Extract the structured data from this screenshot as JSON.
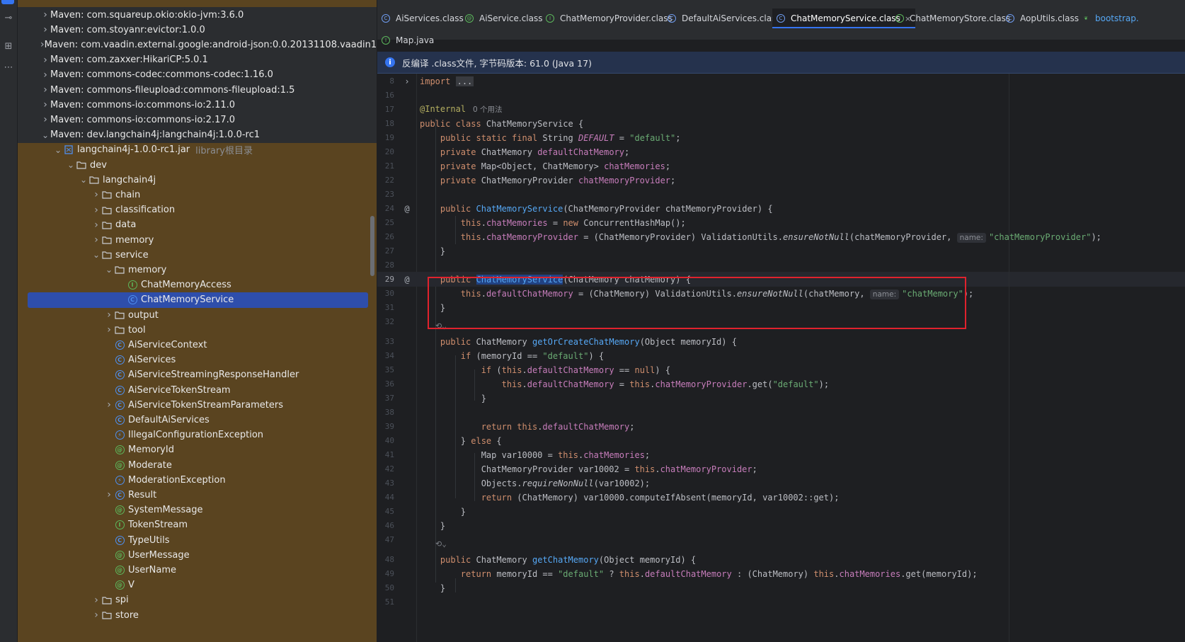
{
  "tool_window": {
    "icons": [
      "commit-icon",
      "structure-icon",
      "more-icon"
    ]
  },
  "project_tree": {
    "rows": [
      {
        "label": "Maven: com.squareup.okio:okio-jvm:3.6.0",
        "depth": 0,
        "type": "library",
        "expanded": false
      },
      {
        "label": "Maven: com.stoyanr:evictor:1.0.0",
        "depth": 0,
        "type": "library",
        "expanded": false
      },
      {
        "label": "Maven: com.vaadin.external.google:android-json:0.0.20131108.vaadin1",
        "depth": 0,
        "type": "library",
        "expanded": false
      },
      {
        "label": "Maven: com.zaxxer:HikariCP:5.0.1",
        "depth": 0,
        "type": "library",
        "expanded": false
      },
      {
        "label": "Maven: commons-codec:commons-codec:1.16.0",
        "depth": 0,
        "type": "library",
        "expanded": false
      },
      {
        "label": "Maven: commons-fileupload:commons-fileupload:1.5",
        "depth": 0,
        "type": "library",
        "expanded": false
      },
      {
        "label": "Maven: commons-io:commons-io:2.11.0",
        "depth": 0,
        "type": "library",
        "expanded": false
      },
      {
        "label": "Maven: commons-io:commons-io:2.17.0",
        "depth": 0,
        "type": "library",
        "expanded": false
      },
      {
        "label": "Maven: dev.langchain4j:langchain4j:1.0.0-rc1",
        "depth": 0,
        "type": "library",
        "expanded": true
      },
      {
        "label": "langchain4j-1.0.0-rc1.jar",
        "suffix": "library根目录",
        "depth": 1,
        "type": "jar",
        "expanded": true
      },
      {
        "label": "dev",
        "depth": 2,
        "type": "folder",
        "expanded": true
      },
      {
        "label": "langchain4j",
        "depth": 3,
        "type": "folder",
        "expanded": true
      },
      {
        "label": "chain",
        "depth": 4,
        "type": "folder",
        "expanded": false
      },
      {
        "label": "classification",
        "depth": 4,
        "type": "folder",
        "expanded": false
      },
      {
        "label": "data",
        "depth": 4,
        "type": "folder",
        "expanded": false
      },
      {
        "label": "memory",
        "depth": 4,
        "type": "folder",
        "expanded": false
      },
      {
        "label": "service",
        "depth": 4,
        "type": "folder",
        "expanded": true
      },
      {
        "label": "memory",
        "depth": 5,
        "type": "folder",
        "expanded": true
      },
      {
        "label": "ChatMemoryAccess",
        "depth": 6,
        "type": "interface"
      },
      {
        "label": "ChatMemoryService",
        "depth": 6,
        "type": "class",
        "selected": true
      },
      {
        "label": "output",
        "depth": 5,
        "type": "folder",
        "expanded": false
      },
      {
        "label": "tool",
        "depth": 5,
        "type": "folder",
        "expanded": false
      },
      {
        "label": "AiServiceContext",
        "depth": 5,
        "type": "class"
      },
      {
        "label": "AiServices",
        "depth": 5,
        "type": "class"
      },
      {
        "label": "AiServiceStreamingResponseHandler",
        "depth": 5,
        "type": "class"
      },
      {
        "label": "AiServiceTokenStream",
        "depth": 5,
        "type": "class"
      },
      {
        "label": "AiServiceTokenStreamParameters",
        "depth": 5,
        "type": "class",
        "expandable": true
      },
      {
        "label": "DefaultAiServices",
        "depth": 5,
        "type": "class"
      },
      {
        "label": "IllegalConfigurationException",
        "depth": 5,
        "type": "exception"
      },
      {
        "label": "MemoryId",
        "depth": 5,
        "type": "annotation"
      },
      {
        "label": "Moderate",
        "depth": 5,
        "type": "annotation"
      },
      {
        "label": "ModerationException",
        "depth": 5,
        "type": "exception"
      },
      {
        "label": "Result",
        "depth": 5,
        "type": "class",
        "expandable": true
      },
      {
        "label": "SystemMessage",
        "depth": 5,
        "type": "annotation"
      },
      {
        "label": "TokenStream",
        "depth": 5,
        "type": "interface"
      },
      {
        "label": "TypeUtils",
        "depth": 5,
        "type": "class"
      },
      {
        "label": "UserMessage",
        "depth": 5,
        "type": "annotation"
      },
      {
        "label": "UserName",
        "depth": 5,
        "type": "annotation"
      },
      {
        "label": "V",
        "depth": 5,
        "type": "annotation"
      },
      {
        "label": "spi",
        "depth": 4,
        "type": "folder",
        "expanded": false
      },
      {
        "label": "store",
        "depth": 4,
        "type": "folder",
        "expanded": false
      }
    ]
  },
  "editor_tabs": {
    "row1": [
      {
        "label": "AiServices.class",
        "icon": "class-icon"
      },
      {
        "label": "AiService.class",
        "icon": "annotation-icon"
      },
      {
        "label": "ChatMemoryProvider.class",
        "icon": "interface-icon"
      },
      {
        "label": "DefaultAiServices.class",
        "icon": "class-icon"
      },
      {
        "label": "ChatMemoryService.class",
        "icon": "class-icon",
        "active": true
      },
      {
        "label": "ChatMemoryStore.class",
        "icon": "interface-icon"
      },
      {
        "label": "AopUtils.class",
        "icon": "class-icon"
      },
      {
        "label": "bootstrap.",
        "icon": "leaf-icon"
      }
    ],
    "row2": [
      {
        "label": "Map.java",
        "icon": "interface-icon"
      }
    ],
    "close_glyph": "×"
  },
  "banner": {
    "text": "反编译 .class文件, 字节码版本: 61.0 (Java 17)"
  },
  "editor": {
    "hint_label": "name:",
    "usage_text": "0 个用法",
    "fold_text": "...",
    "line_numbers": [
      "8",
      "16",
      "17",
      "18",
      "19",
      "20",
      "21",
      "22",
      "23",
      "24",
      "25",
      "26",
      "27",
      "28",
      "29",
      "30",
      "31",
      "32",
      "33",
      "34",
      "35",
      "36",
      "37",
      "38",
      "39",
      "40",
      "41",
      "42",
      "43",
      "44",
      "45",
      "46",
      "47",
      "48",
      "49",
      "50",
      "51"
    ]
  }
}
